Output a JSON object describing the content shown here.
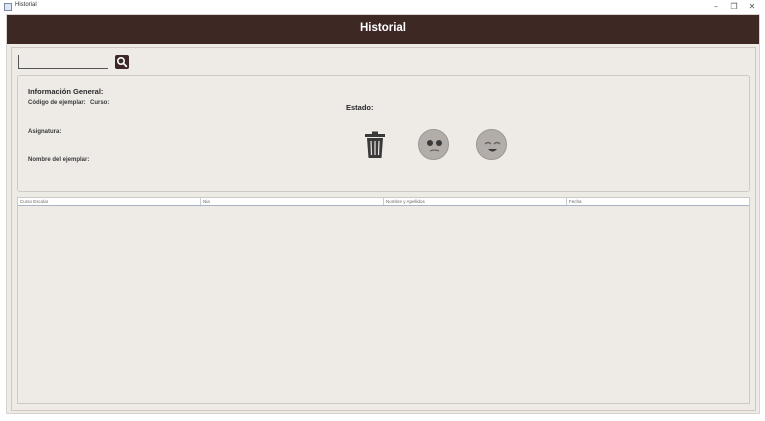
{
  "window": {
    "title": "Historial",
    "controls": [
      "–",
      "❐",
      "✕"
    ]
  },
  "header": {
    "title": "Historial"
  },
  "search": {
    "value": "",
    "placeholder": "",
    "icon": "search-icon"
  },
  "info": {
    "heading": "Información General:",
    "codigo_label": "Código de ejemplar:",
    "curso_label": "Curso:",
    "asignatura_label": "Asignatura:",
    "nombre_label": "Nombre del ejemplar:",
    "estado_label": "Estado:"
  },
  "actions": {
    "delete_icon": "trash-icon",
    "sad_face_icon": "sad-face-icon",
    "happy_face_icon": "happy-face-icon"
  },
  "table": {
    "columns": [
      "Curso Escolar",
      "Nia",
      "Nombre y Apellidos",
      "Fecha"
    ],
    "rows": []
  },
  "colors": {
    "header_bg": "#3d2823",
    "panel_bg": "#eeebe7",
    "face_gray": "#b3ada9"
  }
}
